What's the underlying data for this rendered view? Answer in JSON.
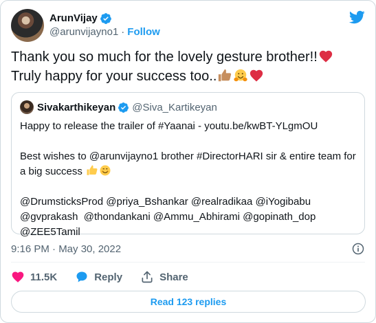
{
  "author": {
    "name": "ArunVijay",
    "handle": "@arunvijayno1",
    "separator": "·",
    "follow_label": "Follow"
  },
  "tweet": {
    "line1": "Thank you so much for the lovely gesture brother!!",
    "line2": "Truly happy for your success too..",
    "emojis": [
      "red-heart",
      "thumbs-up-medium-skin",
      "hugging-face",
      "red-heart"
    ]
  },
  "quote": {
    "name": "Sivakarthikeyan",
    "handle": "@Siva_Kartikeyan",
    "para1": "Happy to release the trailer of #Yaanai - youtu.be/kwBT-YLgmOU",
    "para2_line1": "Best wishes to @arunvijayno1 brother #DirectorHARI sir & entire team for",
    "para2_line2": "a big success",
    "para3_line1": "@DrumsticksProd @priya_Bshankar @realradikaa @iYogibabu",
    "para3_line2": "@gvprakash  @thondankani @Ammu_Abhirami @gopinath_dop",
    "para3_line3": "@ZEE5Tamil"
  },
  "meta": {
    "timestamp": "9:16 PM · May 30, 2022"
  },
  "actions": {
    "like_count": "11.5K",
    "reply_label": "Reply",
    "share_label": "Share"
  },
  "read_replies": "Read 123 replies",
  "colors": {
    "accent": "#1d9bf0",
    "like": "#f91880",
    "text": "#0f1419",
    "muted": "#536471",
    "border": "#cfd9de"
  }
}
